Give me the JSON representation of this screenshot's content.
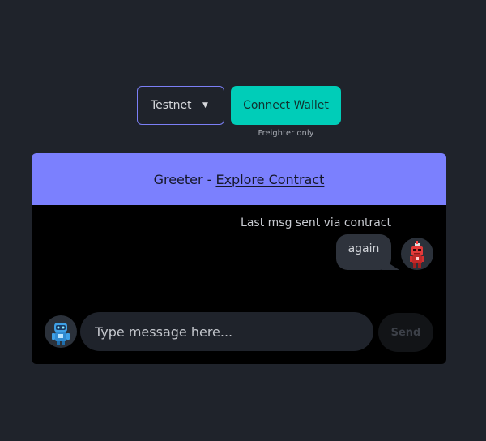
{
  "toolbar": {
    "network": {
      "selected": "Testnet",
      "caret_icon": "caret-down-icon"
    },
    "connect_label": "Connect Wallet",
    "connect_hint": "Freighter only"
  },
  "card": {
    "header_prefix": "Greeter -",
    "header_link": "Explore Contract",
    "last_msg_caption": "Last msg sent via contract",
    "last_msg": "again",
    "contract_avatar_icon": "red-robot-icon",
    "user_avatar_icon": "blue-robot-icon",
    "composer": {
      "placeholder": "Type message here...",
      "value": ""
    },
    "send_label": "Send"
  },
  "colors": {
    "background": "#1f232b",
    "accent_purple": "#7b80fe",
    "accent_teal": "#00cdb8",
    "card_body": "#000000",
    "bubble": "#2e333c"
  }
}
